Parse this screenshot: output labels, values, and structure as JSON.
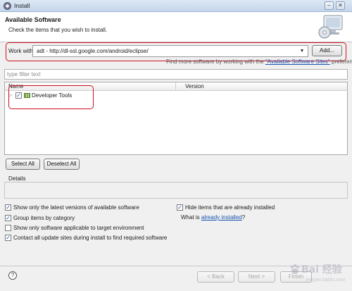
{
  "window": {
    "title": "Install",
    "controls": {
      "minimize": "–",
      "close": "✕"
    }
  },
  "header": {
    "title": "Available Software",
    "description": "Check the items that you wish to install."
  },
  "work_with": {
    "label": "Work with:",
    "value": "adt - http://dl-ssl.google.com/android/eclipse/",
    "add_button": "Add...",
    "find_more_prefix": "Find more software by working with the",
    "find_more_link": "\"Available Software Sites\"",
    "find_more_suffix": "preferences."
  },
  "filter": {
    "placeholder": "type filter text"
  },
  "tree": {
    "columns": [
      "Name",
      "Version"
    ],
    "rows": [
      {
        "label": "Developer Tools",
        "version": "",
        "checked": true
      }
    ]
  },
  "buttons": {
    "select_all": "Select All",
    "deselect_all": "Deselect All"
  },
  "details": {
    "label": "Details"
  },
  "options": {
    "latest_versions": {
      "label": "Show only the latest versions of available software",
      "checked": true
    },
    "group_by_category": {
      "label": "Group items by category",
      "checked": true
    },
    "target_environment": {
      "label": "Show only software applicable to target environment",
      "checked": false
    },
    "contact_update_sites": {
      "label": "Contact all update sites during install to find required software",
      "checked": true
    },
    "hide_installed": {
      "label": "Hide items that are already installed",
      "checked": true
    }
  },
  "what_is": {
    "prefix": "What is",
    "link": "already installed",
    "suffix": "?"
  },
  "footer": {
    "help": "?",
    "back": "< Back",
    "next": "Next >",
    "finish": "Finish"
  },
  "watermark": {
    "text": "Bai 经验",
    "sub": "jingyan.baidu.com"
  },
  "colors": {
    "highlight_box": "#cc1020",
    "link": "#1a55b0",
    "title_bar": "#c5d6ea"
  }
}
